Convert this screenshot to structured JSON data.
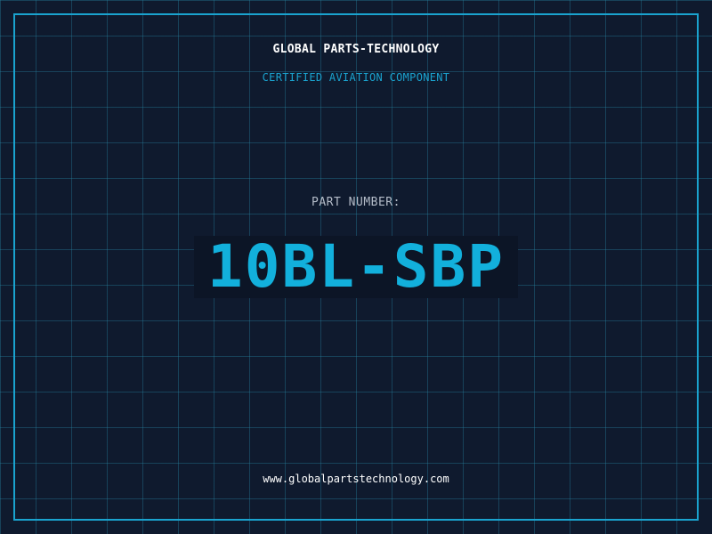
{
  "header": {
    "company": "GLOBAL PARTS-TECHNOLOGY",
    "subtitle": "CERTIFIED AVIATION COMPONENT"
  },
  "part": {
    "label": "PART NUMBER:",
    "number": "10BL-SBP"
  },
  "footer": {
    "url": "www.globalpartstechnology.com"
  },
  "colors": {
    "background": "#0f1a2e",
    "accent": "#1aa3cf",
    "text": "#ffffff",
    "muted": "#b4bcc8"
  }
}
